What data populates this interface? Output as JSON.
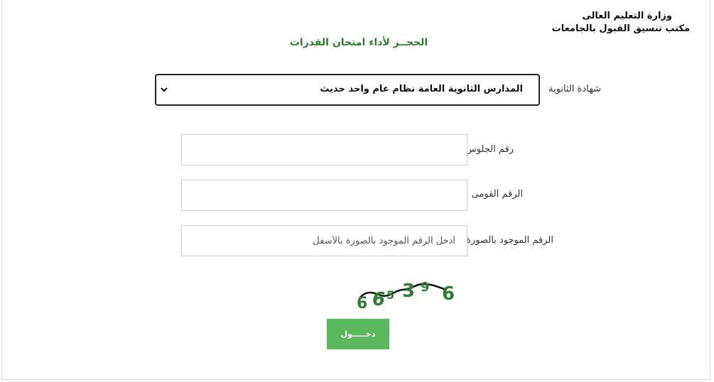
{
  "header": {
    "ministry": "وزارة التعليم العالى",
    "office": "مكتب تنسيق القبول بالجامعات"
  },
  "page_title": "الحجــز لأداء امتحان القدرات",
  "form": {
    "certificate": {
      "label": "شهادة الثانوية",
      "selected": "المدارس الثانوية العامة نظام عام واحد حديث"
    },
    "seat_number": {
      "label": "رقم الجلوس",
      "value": "",
      "placeholder": ""
    },
    "national_id": {
      "label": "الرقم القومى",
      "value": "",
      "placeholder": ""
    },
    "captcha_input": {
      "label": "الرقم الموجود بالصورة",
      "value": "",
      "placeholder": "أدخل الرقم الموجود بالصورة بالأسفل"
    },
    "captcha_image": {
      "digits": [
        "6",
        "6",
        "5",
        "3",
        "9",
        "6"
      ],
      "color": "#2e7d32"
    },
    "submit_label": "دخـــــول"
  },
  "colors": {
    "title_green": "#2e7d32",
    "button_green": "#5cb85c"
  },
  "icons": {
    "select_arrow": "chevron-down-icon"
  }
}
